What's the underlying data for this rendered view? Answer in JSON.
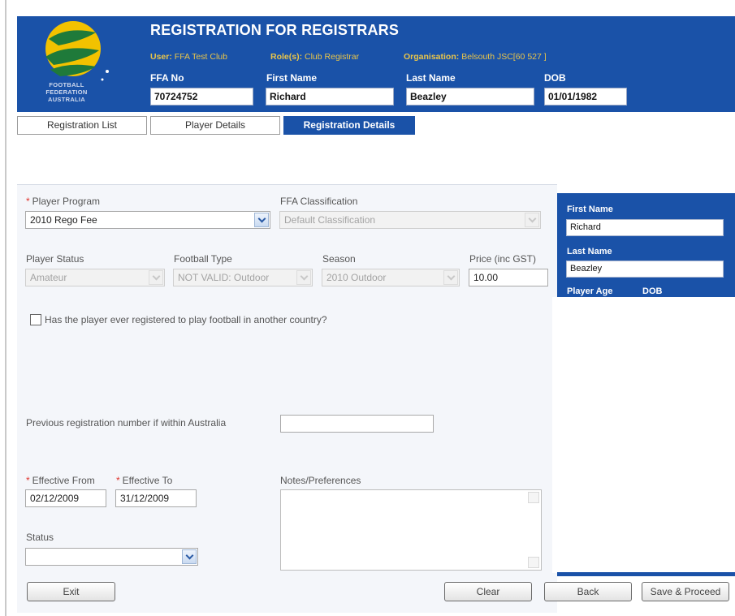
{
  "header": {
    "title": "REGISTRATION FOR REGISTRARS",
    "logo_text": [
      "FOOTBALL",
      "FEDERATION",
      "AUSTRALIA"
    ],
    "user_label": "User:",
    "user_value": "FFA Test Club",
    "roles_label": "Role(s):",
    "roles_value": "Club Registrar",
    "org_label": "Organisation:",
    "org_value": "Belsouth JSC[60 527 ]",
    "ffa_no_label": "FFA No",
    "ffa_no_value": "70724752",
    "first_name_label": "First Name",
    "first_name_value": "Richard",
    "last_name_label": "Last Name",
    "last_name_value": "Beazley",
    "dob_label": "DOB",
    "dob_value": "01/01/1982"
  },
  "tabs": [
    {
      "label": "Registration List"
    },
    {
      "label": "Player Details"
    },
    {
      "label": "Registration Details"
    }
  ],
  "form": {
    "player_program_label": "Player Program",
    "player_program_value": "2010 Rego Fee",
    "ffa_classification_label": "FFA Classification",
    "ffa_classification_value": "Default Classification",
    "player_status_label": "Player Status",
    "player_status_value": "Amateur",
    "football_type_label": "Football Type",
    "football_type_value": "NOT VALID: Outdoor",
    "season_label": "Season",
    "season_value": "2010 Outdoor",
    "price_label": "Price (inc GST)",
    "price_value": "10.00",
    "overseas_question": "Has the player ever registered to play football in another country?",
    "prev_reg_label": "Previous registration number if within Australia",
    "prev_reg_value": "",
    "effective_from_label": "Effective From",
    "effective_from_value": "02/12/2009",
    "effective_to_label": "Effective To",
    "effective_to_value": "31/12/2009",
    "notes_label": "Notes/Preferences",
    "notes_value": "",
    "status_label": "Status",
    "status_value": ""
  },
  "side": {
    "first_name_label": "First Name",
    "first_name_value": "Richard",
    "last_name_label": "Last Name",
    "last_name_value": "Beazley",
    "player_age_label": "Player Age",
    "dob_label": "DOB"
  },
  "buttons": {
    "exit": "Exit",
    "clear": "Clear",
    "back": "Back",
    "save_proceed": "Save & Proceed"
  },
  "colors": {
    "header_blue": "#1a52a8",
    "meta_gold": "#e9c54a",
    "required_red": "#e0332d"
  }
}
